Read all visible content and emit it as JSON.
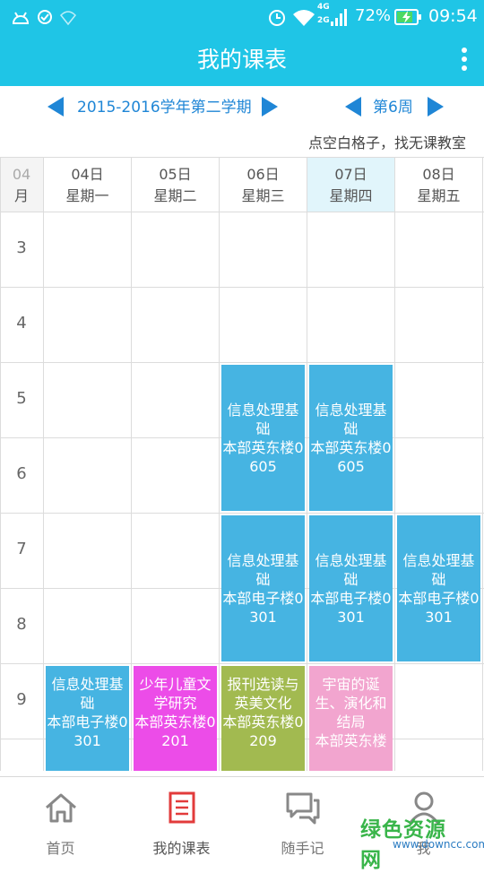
{
  "status": {
    "network": "4G",
    "network2": "2G",
    "battery": "72%",
    "time": "09:54"
  },
  "app": {
    "title": "我的课表"
  },
  "nav": {
    "semester": "2015-2016学年第二学期",
    "week": "第6周"
  },
  "hint": "点空白格子，找无课教室",
  "month": {
    "value": "04",
    "unit": "月"
  },
  "days": [
    {
      "date": "04日",
      "weekday": "星期一",
      "today": false
    },
    {
      "date": "05日",
      "weekday": "星期二",
      "today": false
    },
    {
      "date": "06日",
      "weekday": "星期三",
      "today": false
    },
    {
      "date": "07日",
      "weekday": "星期四",
      "today": true
    },
    {
      "date": "08日",
      "weekday": "星期五",
      "today": false
    }
  ],
  "periods": [
    "3",
    "4",
    "5",
    "6",
    "7",
    "8",
    "9"
  ],
  "courses": [
    {
      "day": 2,
      "start": "5",
      "end": "6",
      "name": "信息处理基础",
      "location": "本部英东楼0605",
      "color": "#46b4e2"
    },
    {
      "day": 3,
      "start": "5",
      "end": "6",
      "name": "信息处理基础",
      "location": "本部英东楼0605",
      "color": "#46b4e2"
    },
    {
      "day": 2,
      "start": "7",
      "end": "8",
      "name": "信息处理基础",
      "location": "本部电子楼0301",
      "color": "#46b4e2"
    },
    {
      "day": 3,
      "start": "7",
      "end": "8",
      "name": "信息处理基础",
      "location": "本部电子楼0301",
      "color": "#46b4e2"
    },
    {
      "day": 4,
      "start": "7",
      "end": "8",
      "name": "信息处理基础",
      "location": "本部电子楼0301",
      "color": "#46b4e2"
    },
    {
      "day": 0,
      "start": "9",
      "end": "10",
      "name": "信息处理基础",
      "location": "本部电子楼0301",
      "color": "#46b4e2"
    },
    {
      "day": 1,
      "start": "9",
      "end": "10",
      "name": "少年儿童文学研究",
      "location": "本部英东楼0201",
      "color": "#ec4ce8"
    },
    {
      "day": 2,
      "start": "9",
      "end": "10",
      "name": "报刊选读与英美文化",
      "location": "本部英东楼0209",
      "color": "#a2ba50"
    },
    {
      "day": 3,
      "start": "9",
      "end": "10",
      "name": "宇宙的诞生、演化和结局",
      "location": "本部英东楼",
      "color": "#f2a5cf"
    }
  ],
  "bottom_nav": [
    {
      "label": "首页",
      "icon": "home-icon",
      "active": false
    },
    {
      "label": "我的课表",
      "icon": "schedule-icon",
      "active": true
    },
    {
      "label": "随手记",
      "icon": "chat-icon",
      "active": false
    },
    {
      "label": "我",
      "icon": "user-icon",
      "active": false
    }
  ],
  "watermark": {
    "main": "绿色资源网",
    "sub": "www.downcc.com"
  },
  "colors": {
    "primary": "#1fc5e6",
    "accent": "#1f86d6",
    "active_tab": "#e23b3b",
    "today_header": "#e1f5fb"
  }
}
